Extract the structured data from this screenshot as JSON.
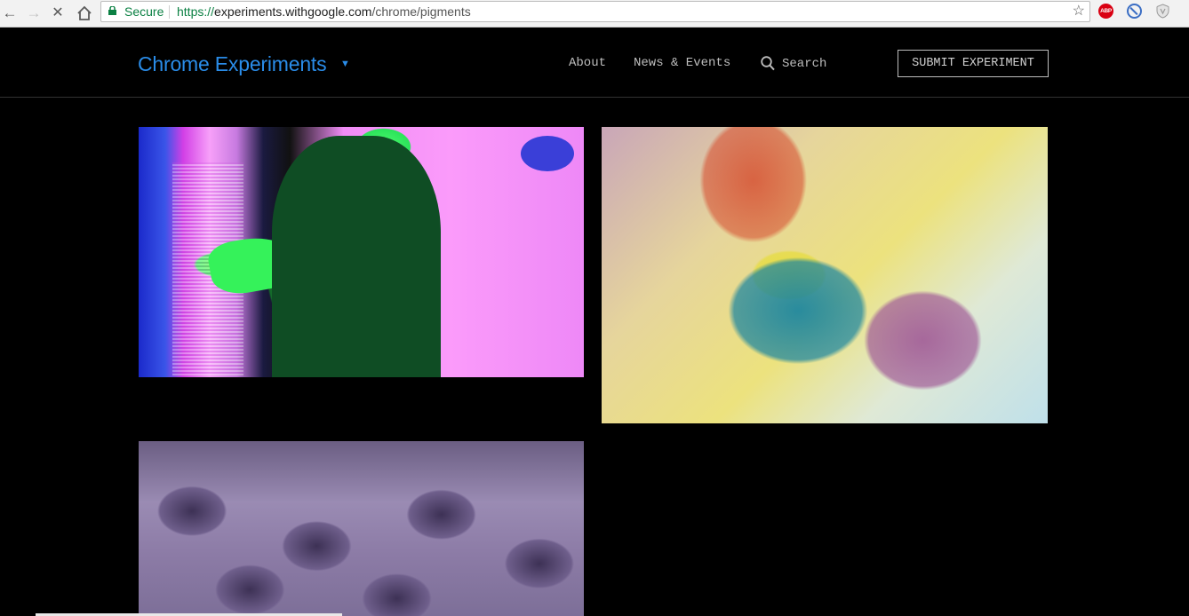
{
  "browser": {
    "secure_label": "Secure",
    "url_scheme": "https://",
    "url_host": "experiments.withgoogle.com",
    "url_path": "/chrome/pigments",
    "extensions": [
      {
        "name": "adblock-plus-icon",
        "label": "ABP"
      },
      {
        "name": "block-icon"
      },
      {
        "name": "shield-icon"
      }
    ]
  },
  "header": {
    "logo": "Chrome Experiments",
    "logo_caret": "▼",
    "nav": {
      "about": "About",
      "news": "News & Events",
      "search": "Search"
    },
    "submit_label": "SUBMIT EXPERIMENT"
  },
  "colors": {
    "accent": "#2a8ce8",
    "background": "#000000",
    "secure_green": "#0b8043"
  },
  "experiments": [
    {
      "name": "experiment-card-1",
      "thumbnail": "neon pink and green video still"
    },
    {
      "name": "experiment-card-2",
      "thumbnail": "multicolor overlapping figure"
    },
    {
      "name": "experiment-card-3",
      "thumbnail": "purple repeating arches"
    }
  ]
}
